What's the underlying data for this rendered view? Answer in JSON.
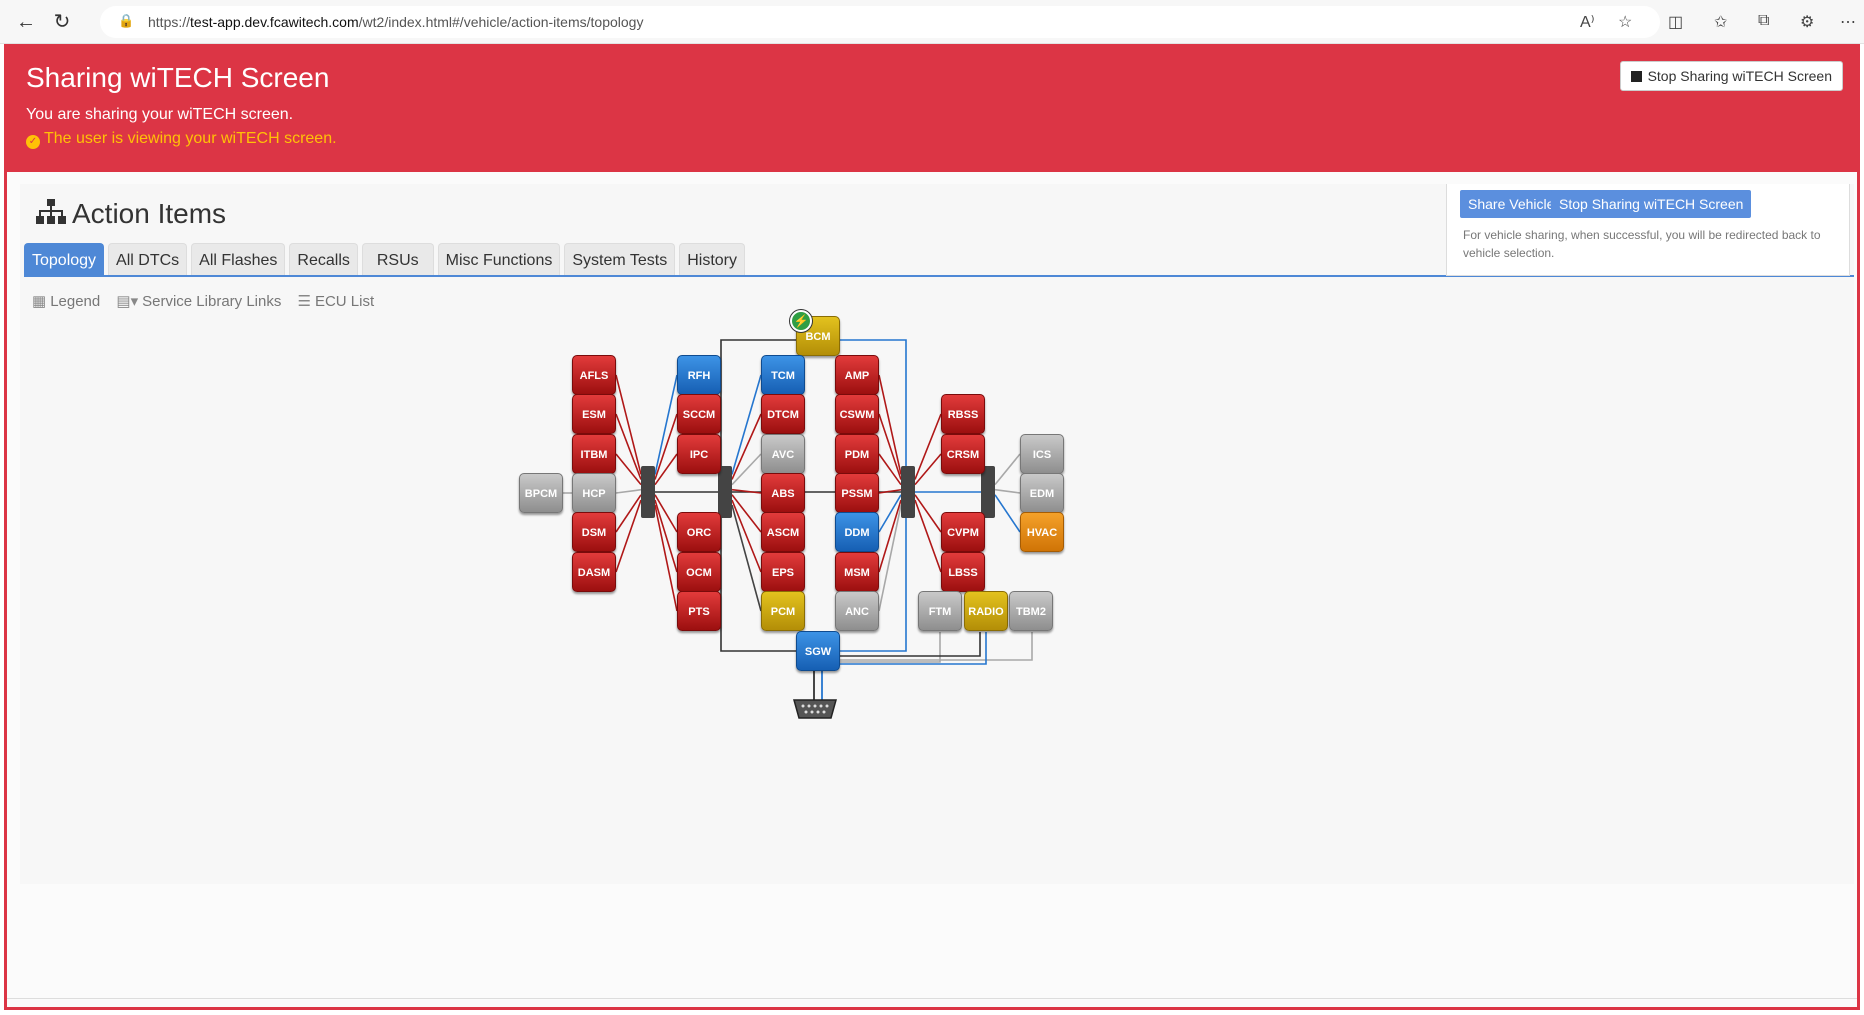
{
  "browser": {
    "back_icon": "back-arrow-icon",
    "refresh_icon": "refresh-icon",
    "url_prefix": "https://",
    "url_host": "test-app.dev.fcawitech.com",
    "url_path": "/wt2/index.html#/vehicle/action-items/topology"
  },
  "share": {
    "title": "Sharing wiTECH Screen",
    "subtitle": "You are sharing your wiTECH screen.",
    "viewing": "The user is viewing your wiTECH screen.",
    "stop_label": "Stop Sharing wiTECH Screen",
    "banner_color": "#dc3545"
  },
  "page": {
    "title": "Action Items"
  },
  "tabs": [
    {
      "label": "Topology",
      "active": true
    },
    {
      "label": "All DTCs"
    },
    {
      "label": "All Flashes"
    },
    {
      "label": "Recalls"
    },
    {
      "label": "RSUs"
    },
    {
      "label": "Misc Functions"
    },
    {
      "label": "System Tests"
    },
    {
      "label": "History"
    }
  ],
  "side": {
    "share_vehicle": "Share Vehicle",
    "stop_sharing": "Stop Sharing wiTECH Screen",
    "note": "For vehicle sharing, when successful, you will be redirected back to vehicle selection."
  },
  "tools": {
    "legend": "Legend",
    "service_library": "Service Library Links",
    "ecu_list": "ECU List"
  },
  "colors": {
    "red": "#c41e1e",
    "blue": "#2576cf",
    "gray": "#a8a8a8",
    "yellow": "#d1ab12",
    "orange": "#e88a12"
  },
  "ecus": [
    {
      "id": "BCM",
      "color": "yellow",
      "flash": true
    },
    {
      "id": "AFLS",
      "color": "red"
    },
    {
      "id": "ESM",
      "color": "red"
    },
    {
      "id": "ITBM",
      "color": "red"
    },
    {
      "id": "HCP",
      "color": "gray"
    },
    {
      "id": "BPCM",
      "color": "gray"
    },
    {
      "id": "DSM",
      "color": "red"
    },
    {
      "id": "DASM",
      "color": "red"
    },
    {
      "id": "RFH",
      "color": "blue"
    },
    {
      "id": "SCCM",
      "color": "red"
    },
    {
      "id": "IPC",
      "color": "red"
    },
    {
      "id": "ORC",
      "color": "red"
    },
    {
      "id": "OCM",
      "color": "red"
    },
    {
      "id": "PTS",
      "color": "red"
    },
    {
      "id": "TCM",
      "color": "blue"
    },
    {
      "id": "DTCM",
      "color": "red"
    },
    {
      "id": "AVC",
      "color": "gray"
    },
    {
      "id": "ABS",
      "color": "red"
    },
    {
      "id": "ASCM",
      "color": "red"
    },
    {
      "id": "EPS",
      "color": "red"
    },
    {
      "id": "PCM",
      "color": "yellow"
    },
    {
      "id": "AMP",
      "color": "red"
    },
    {
      "id": "CSWM",
      "color": "red"
    },
    {
      "id": "PDM",
      "color": "red"
    },
    {
      "id": "PSSM",
      "color": "red"
    },
    {
      "id": "DDM",
      "color": "blue"
    },
    {
      "id": "MSM",
      "color": "red"
    },
    {
      "id": "ANC",
      "color": "gray"
    },
    {
      "id": "RBSS",
      "color": "red"
    },
    {
      "id": "CRSM",
      "color": "red"
    },
    {
      "id": "CVPM",
      "color": "red"
    },
    {
      "id": "LBSS",
      "color": "red"
    },
    {
      "id": "ICS",
      "color": "gray"
    },
    {
      "id": "EDM",
      "color": "gray"
    },
    {
      "id": "HVAC",
      "color": "orange"
    },
    {
      "id": "FTM",
      "color": "gray"
    },
    {
      "id": "RADIO",
      "color": "yellow"
    },
    {
      "id": "TBM2",
      "color": "gray"
    },
    {
      "id": "SGW",
      "color": "blue"
    }
  ]
}
